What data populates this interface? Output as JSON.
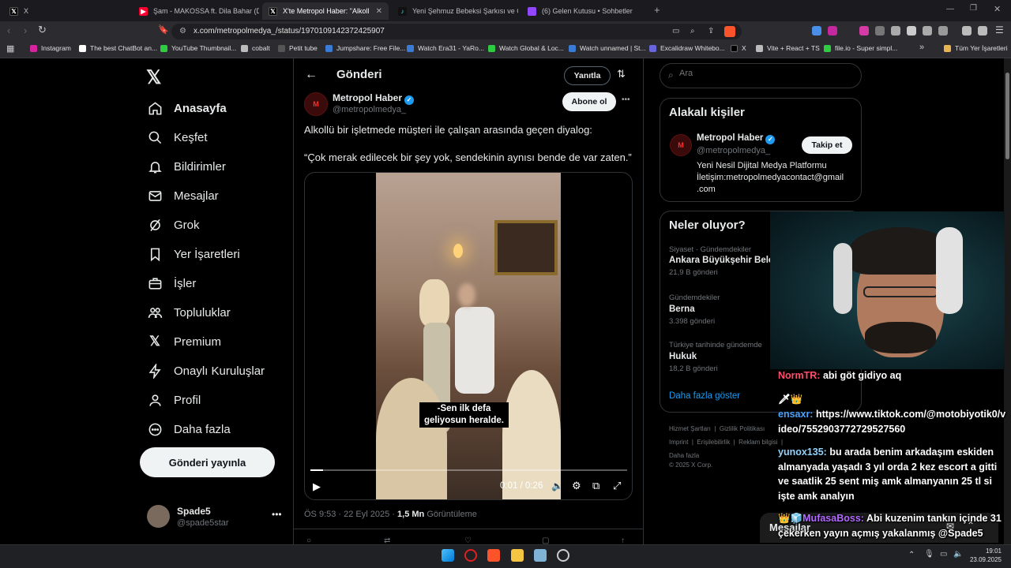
{
  "browser": {
    "tabs": [
      {
        "title": "X",
        "icon": "x-logo-icon"
      },
      {
        "title": "Şam - MAKOSSA ft. Dila Bahar (Direc",
        "icon": "youtube-icon"
      },
      {
        "title": "X'te Metropol Haber: \"Alkollü bir",
        "icon": "x-logo-icon",
        "active": true
      },
      {
        "title": "Yeni Şehmuz Bebeksi Şarkısı ve Çıkış",
        "icon": "tiktok-icon"
      },
      {
        "title": "(6) Gelen Kutusu • Sohbetler",
        "icon": "inbox-icon"
      }
    ],
    "new_tab": "+",
    "url": "x.com/metropolmedya_/status/1970109142372425907",
    "bookmarks": [
      {
        "label": "Instagram",
        "color": "#d6249f"
      },
      {
        "label": "The best ChatBot an...",
        "color": "#ffffff"
      },
      {
        "label": "YouTube Thumbnail...",
        "color": "#2ecc40"
      },
      {
        "label": "cobalt",
        "color": "#bbbbbb"
      },
      {
        "label": "Petit tube",
        "color": "#555555"
      },
      {
        "label": "Jumpshare: Free File...",
        "color": "#3a7bd5"
      },
      {
        "label": "Watch Era31 - YaRo...",
        "color": "#3a7bd5"
      },
      {
        "label": "Watch Global & Loc...",
        "color": "#2ecc40"
      },
      {
        "label": "Watch unnamed | St...",
        "color": "#3a7bd5"
      },
      {
        "label": "Excalidraw Whitebo...",
        "color": "#6965db"
      },
      {
        "label": "X",
        "color": "#000000"
      },
      {
        "label": "Vite + React + TS",
        "color": "#bbbbbb"
      },
      {
        "label": "file.io - Super simpl...",
        "color": "#2ecc40"
      }
    ],
    "more_bookmarks": "»",
    "all_bookmarks": "Tüm Yer İşaretleri"
  },
  "nav": {
    "items": [
      {
        "label": "Anasayfa",
        "icon": "home-icon"
      },
      {
        "label": "Keşfet",
        "icon": "search-icon"
      },
      {
        "label": "Bildirimler",
        "icon": "bell-icon"
      },
      {
        "label": "Mesajlar",
        "icon": "mail-icon"
      },
      {
        "label": "Grok",
        "icon": "grok-icon"
      },
      {
        "label": "Yer İşaretleri",
        "icon": "bookmark-icon"
      },
      {
        "label": "İşler",
        "icon": "briefcase-icon"
      },
      {
        "label": "Topluluklar",
        "icon": "communities-icon"
      },
      {
        "label": "Premium",
        "icon": "x-logo-icon"
      },
      {
        "label": "Onaylı Kuruluşlar",
        "icon": "lightning-icon"
      },
      {
        "label": "Profil",
        "icon": "profile-icon"
      },
      {
        "label": "Daha fazla",
        "icon": "more-circle-icon"
      }
    ],
    "post_button": "Gönderi yayınla",
    "account": {
      "name": "Spade5",
      "handle": "@spade5star"
    }
  },
  "post": {
    "header_title": "Gönderi",
    "reply_button": "Yanıtla",
    "author_name": "Metropol Haber",
    "author_handle": "@metropolmedya_",
    "follow_button": "Abone ol",
    "text_line1": "Alkollü bir işletmede müşteri ile çalışan arasında geçen diyalog:",
    "text_line2": "“Çok merak edilecek bir şey yok, sendekinin aynısı bende de var zaten.”",
    "video_subtitle_1": "-Sen ilk defa",
    "video_subtitle_2": "geliyosun heralde.",
    "video_time": "0:01 / 0:26",
    "video_progress": 0.04,
    "time": "ÖS 9:53 · 22 Eyl 2025 ·",
    "views_count": "1,5 Mn",
    "views_label": "Görüntüleme"
  },
  "right": {
    "search_placeholder": "Ara",
    "relevant_title": "Alakalı kişiler",
    "relevant_name": "Metropol Haber",
    "relevant_handle": "@metropolmedya_",
    "relevant_follow": "Takip et",
    "relevant_bio_1": "Yeni Nesil Dijital Medya Platformu",
    "relevant_bio_2": "İletişim:metropolmedyacontact@gmail",
    "relevant_bio_3": ".com",
    "trends_title": "Neler oluyor?",
    "trends": [
      {
        "category": "Siyaset · Gündemdekiler",
        "name": "Ankara Büyükşehir Belediyesi",
        "count": "21,9 B gönderi"
      },
      {
        "category": "Gündemdekiler",
        "name": "Berna",
        "count": "3.398 gönderi"
      },
      {
        "category": "Türkiye tarihinde gündemde",
        "name": "Hukuk",
        "count": "18,2 B gönderi"
      }
    ],
    "show_more": "Daha fazla göster",
    "footer_1": "Hizmet Şartları",
    "footer_2": "Gizlilik Politikası",
    "footer_3": "Imprint",
    "footer_4": "Erişilebilirlik",
    "footer_5": "Reklam bilgisi",
    "footer_6": "Daha fazla",
    "copyright": "© 2025 X Corp.",
    "messages_label": "Mesajlar"
  },
  "chat": [
    {
      "user": "NormTR:",
      "user_color": "#ff4d6a",
      "badges": "",
      "text": "abi göt gidiyo aq"
    },
    {
      "user": "ensaxr:",
      "user_color": "#4aa3ff",
      "badges": "🗡👑",
      "text": "https://www.tiktok.com/@motobiyotik0/video/7552903772729527560"
    },
    {
      "user": "yunox135:",
      "user_color": "#8fd3ff",
      "badges": "",
      "text": "bu arada benim arkadaşım eskiden almanyada yaşadı 3 yıl orda 2 kez escort a gitti ve saatlik 25 sent miş amk almanyanın 25 tl si işte amk analyın"
    },
    {
      "user": "MufasaBoss:",
      "user_color": "#b36bff",
      "badges": "👑🧊",
      "text": "Abi kuzenim tankın içinde 31 çekerken yayın açmış yakalanmış @Spade5"
    }
  ],
  "taskbar": {
    "time": "19:01",
    "date": "23.09.2025"
  }
}
